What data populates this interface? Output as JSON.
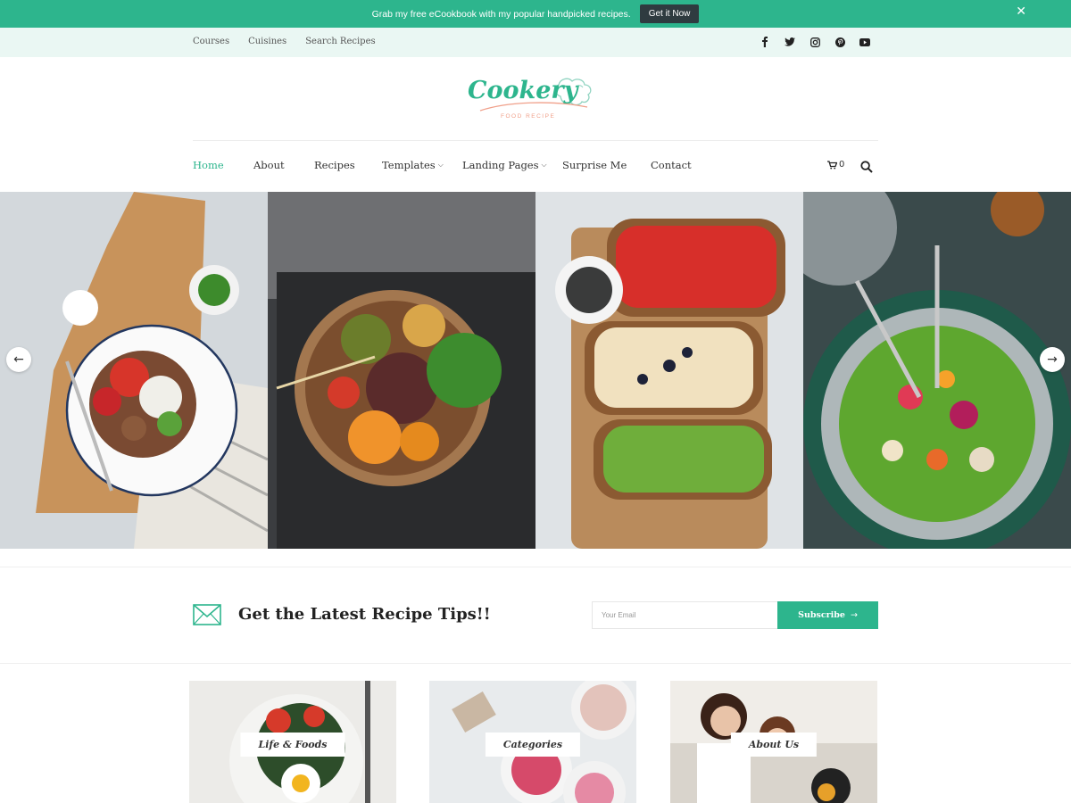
{
  "notice": {
    "text": "Grab my free eCookbook with my popular handpicked recipes.",
    "button_label": "Get it Now",
    "close_icon": "close-icon"
  },
  "top_nav": {
    "links": [
      "Courses",
      "Cuisines",
      "Search Recipes"
    ],
    "social_icons": [
      "facebook-icon",
      "twitter-icon",
      "instagram-icon",
      "pinterest-icon",
      "youtube-icon"
    ]
  },
  "logo": {
    "word": "Cookery",
    "tagline": "FOOD RECIPE"
  },
  "main_nav": {
    "items": [
      {
        "label": "Home",
        "active": true,
        "dropdown": false
      },
      {
        "label": "About",
        "active": false,
        "dropdown": false
      },
      {
        "label": "Recipes",
        "active": false,
        "dropdown": false
      },
      {
        "label": "Templates",
        "active": false,
        "dropdown": true
      },
      {
        "label": "Landing Pages",
        "active": false,
        "dropdown": true
      },
      {
        "label": "Surprise Me",
        "active": false,
        "dropdown": false
      },
      {
        "label": "Contact",
        "active": false,
        "dropdown": false
      }
    ],
    "cart_count": "0"
  },
  "newsletter": {
    "title": "Get the Latest Recipe Tips!!",
    "email_placeholder": "Your Email",
    "button_label": "Subscribe"
  },
  "cards": [
    {
      "label": "Life & Foods"
    },
    {
      "label": "Categories"
    },
    {
      "label": "About Us"
    }
  ],
  "colors": {
    "accent": "#2db58d",
    "topbar_bg": "#eaf7f3",
    "dark_button": "#2f3b40"
  }
}
